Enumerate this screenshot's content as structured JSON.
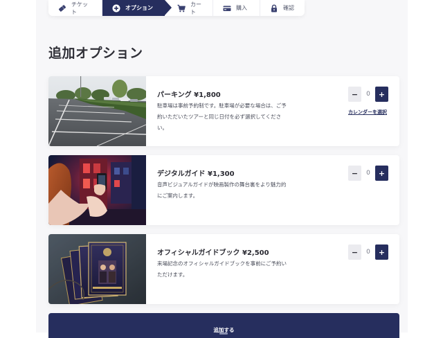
{
  "stepper": {
    "steps": [
      {
        "label": "チケット",
        "icon": "ticket-icon",
        "active": false
      },
      {
        "label": "オプション",
        "icon": "plus-circle-icon",
        "active": true
      },
      {
        "label": "カート",
        "icon": "cart-icon",
        "active": false
      },
      {
        "label": "購入",
        "icon": "credit-card-icon",
        "active": false
      },
      {
        "label": "確認",
        "icon": "lock-icon",
        "active": false
      }
    ]
  },
  "page_title": "追加オプション",
  "options": [
    {
      "name": "パーキング ¥1,800",
      "description": "駐車場は事前予約制です。駐車場が必要な場合は、ご予約いただいたツアーと同じ日付を必ず選択してください。",
      "quantity": "0",
      "minus_label": "−",
      "plus_label": "+",
      "link_label": "カレンダーを選択"
    },
    {
      "name": "デジタルガイド ¥1,300",
      "description": "音声ビジュアルガイドが映画製作の舞台裏をより魅力的にご案内します。",
      "quantity": "0",
      "minus_label": "−",
      "plus_label": "+"
    },
    {
      "name": "オフィシャルガイドブック ¥2,500",
      "description": "来場記念のオフィシャルガイドブックを事前にご予約いただけます。",
      "quantity": "0",
      "minus_label": "−",
      "plus_label": "+"
    }
  ],
  "add_button_label": "追加する",
  "colors": {
    "accent": "#262e5e",
    "background": "#f7f7f9",
    "card": "#ffffff"
  }
}
